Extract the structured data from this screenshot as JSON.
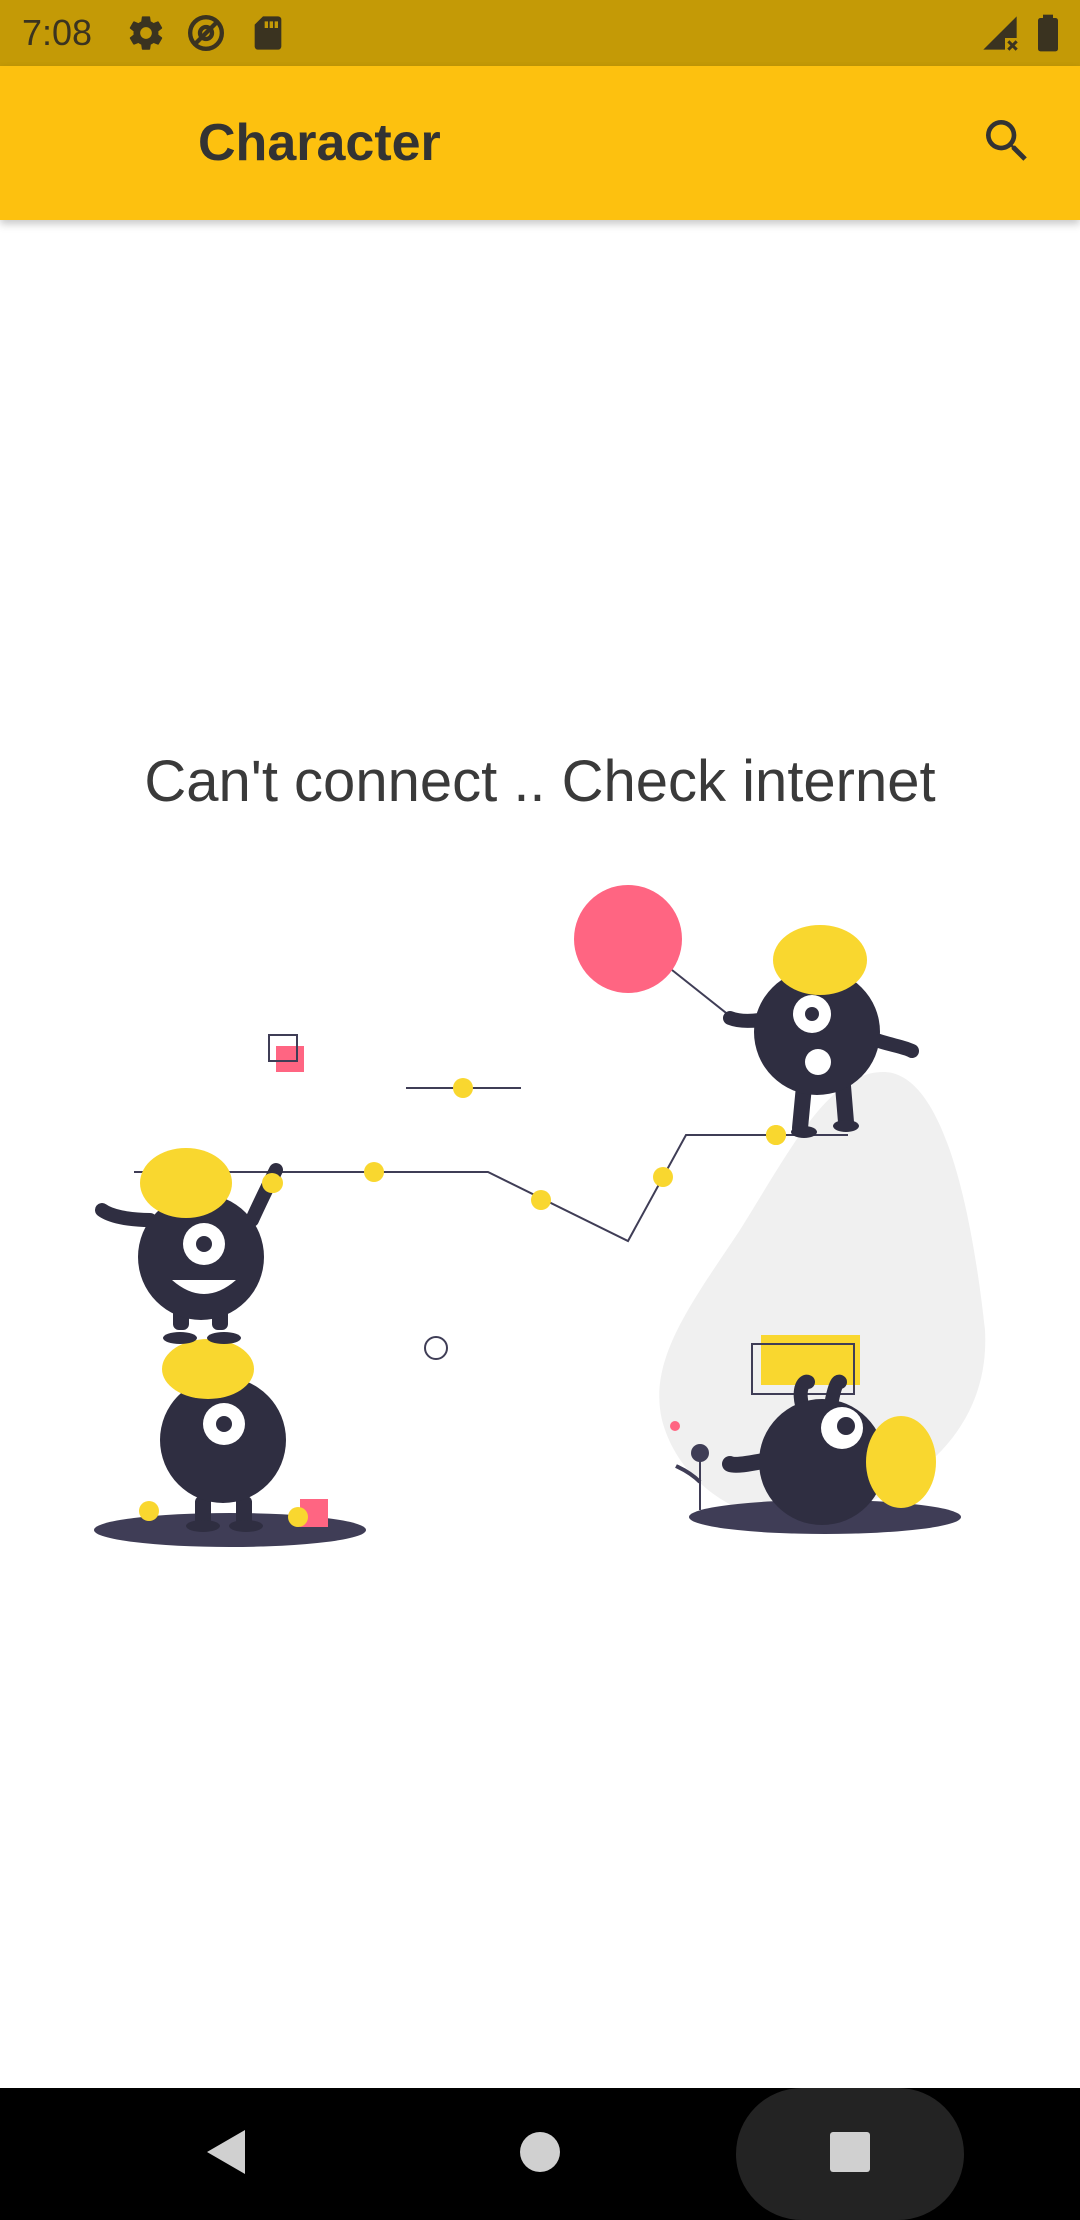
{
  "status_bar": {
    "time": "7:08",
    "left_icons": [
      "gear-icon",
      "at-sign-icon",
      "sd-card-icon"
    ],
    "right_icons": [
      "signal-no-data-icon",
      "battery-icon"
    ],
    "background": "#c49a06"
  },
  "app_bar": {
    "title": "Character",
    "action_icon": "search-icon",
    "background": "#fdc10f"
  },
  "content": {
    "message": "Can't connect .. Check internet",
    "illustration": "monsters-playing-illustration",
    "accent_yellow": "#f9d72f",
    "accent_pink": "#ff6582",
    "character_color": "#2f2e41"
  },
  "nav_bar": {
    "buttons": [
      "back-icon",
      "home-icon",
      "recents-icon"
    ],
    "background": "#000000"
  }
}
